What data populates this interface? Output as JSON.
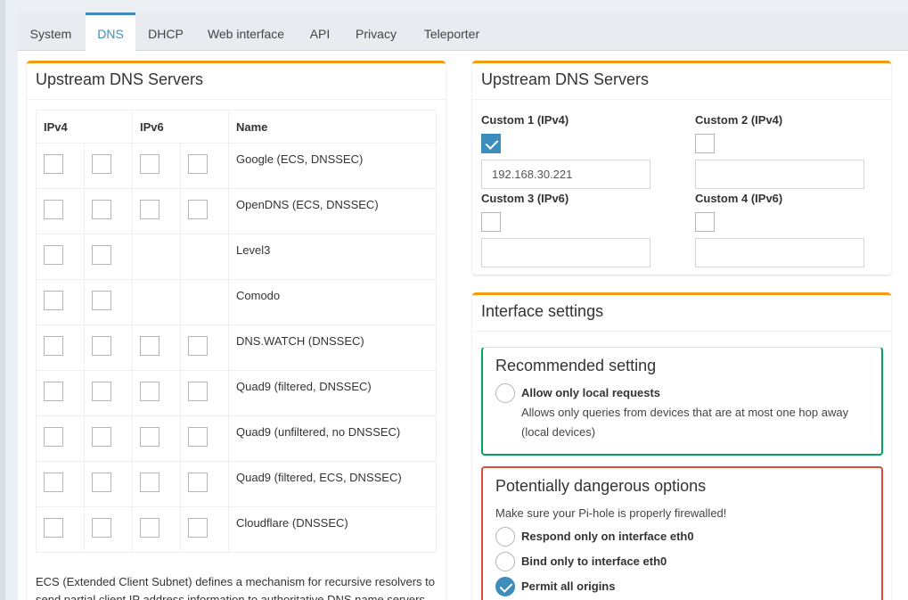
{
  "tabs": [
    "System",
    "DNS",
    "DHCP",
    "Web interface",
    "API",
    "Privacy",
    "Teleporter"
  ],
  "active_tab": "DNS",
  "left_box": {
    "title": "Upstream DNS Servers",
    "headers": {
      "ipv4": "IPv4",
      "ipv6": "IPv6",
      "name": "Name"
    },
    "servers": [
      {
        "name": "Google (ECS, DNSSEC)",
        "has_ipv6": true
      },
      {
        "name": "OpenDNS (ECS, DNSSEC)",
        "has_ipv6": true
      },
      {
        "name": "Level3",
        "has_ipv6": false
      },
      {
        "name": "Comodo",
        "has_ipv6": false
      },
      {
        "name": "DNS.WATCH (DNSSEC)",
        "has_ipv6": true
      },
      {
        "name": "Quad9 (filtered, DNSSEC)",
        "has_ipv6": true
      },
      {
        "name": "Quad9 (unfiltered, no DNSSEC)",
        "has_ipv6": true
      },
      {
        "name": "Quad9 (filtered, ECS, DNSSEC)",
        "has_ipv6": true
      },
      {
        "name": "Cloudflare (DNSSEC)",
        "has_ipv6": true
      }
    ],
    "footnote": "ECS (Extended Client Subnet) defines a mechanism for recursive resolvers to send partial client IP address information to authoritative DNS name servers."
  },
  "right_box": {
    "title": "Upstream DNS Servers",
    "custom1": {
      "label": "Custom 1 (IPv4)",
      "checked": true,
      "value": "192.168.30.221"
    },
    "custom2": {
      "label": "Custom 2 (IPv4)",
      "checked": false,
      "value": ""
    },
    "custom3": {
      "label": "Custom 3 (IPv6)",
      "checked": false,
      "value": ""
    },
    "custom4": {
      "label": "Custom 4 (IPv6)",
      "checked": false,
      "value": ""
    }
  },
  "interface_box": {
    "title": "Interface settings",
    "recommended": {
      "title": "Recommended setting",
      "option": "Allow only local requests",
      "desc_line1": "Allows only queries from devices that are at most one hop away",
      "desc_line2": "(local devices)"
    },
    "dangerous": {
      "title": "Potentially dangerous options",
      "warning": "Make sure your Pi-hole is properly firewalled!",
      "opt1": "Respond only on interface eth0",
      "opt2": "Bind only to interface eth0",
      "opt3": "Permit all origins"
    }
  },
  "colors": {
    "accent": "#3c8dbc",
    "box_top": "#f39c12",
    "recommended": "#00a65a",
    "danger": "#dd4b39"
  }
}
